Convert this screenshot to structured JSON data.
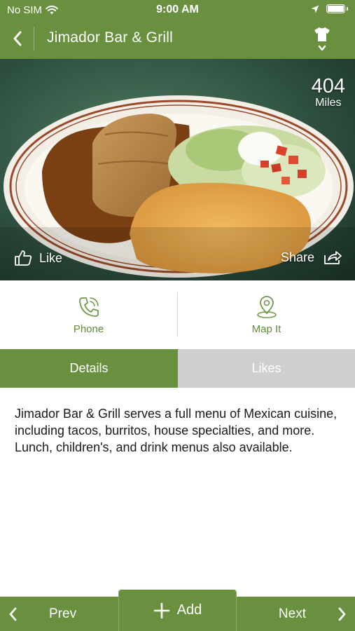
{
  "status_bar": {
    "carrier": "No SIM",
    "time": "9:00 AM"
  },
  "nav": {
    "title": "Jimador Bar & Grill",
    "back_icon": "chevron-left-icon",
    "menu_icon": "shirt-icon"
  },
  "hero": {
    "distance_value": "404",
    "distance_unit": "Miles",
    "like_label": "Like",
    "share_label": "Share"
  },
  "actions": {
    "phone_label": "Phone",
    "map_label": "Map It"
  },
  "tabs": {
    "details_label": "Details",
    "likes_label": "Likes",
    "active": "Details"
  },
  "description": "Jimador Bar & Grill serves a full menu of Mexican cuisine, including tacos, burritos, house specialties, and more. Lunch, children's, and drink menus also available.",
  "bottom_bar": {
    "prev_label": "Prev",
    "add_label": "Add",
    "next_label": "Next"
  },
  "colors": {
    "brand_green": "#68903f",
    "inactive_tab": "#cfcfcf",
    "action_green": "#5f8a3a"
  }
}
